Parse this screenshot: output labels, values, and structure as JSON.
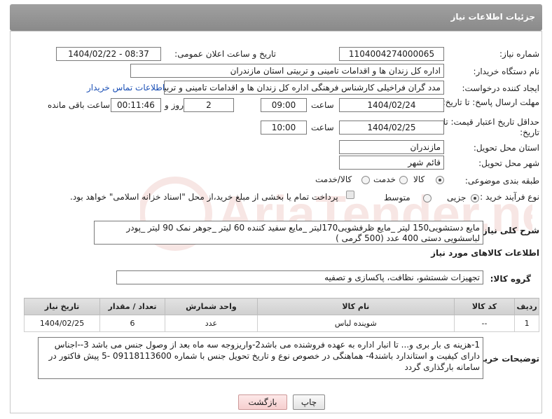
{
  "header": {
    "title": "جزئیات اطلاعات نیاز"
  },
  "labels": {
    "need_number": "شماره نیاز:",
    "announce_datetime": "تاریخ و ساعت اعلان عمومی:",
    "buyer_org": "نام دستگاه خریدار:",
    "requester": "ایجاد کننده درخواست:",
    "reply_deadline": "مهلت ارسال پاسخ: تا تاریخ:",
    "hour": "ساعت",
    "day_and": "روز و",
    "remaining": "ساعت باقی مانده",
    "min_price_validity": "حداقل تاریخ اعتبار قیمت: تا تاریخ:",
    "delivery_province": "استان محل تحویل:",
    "delivery_city": "شهر محل تحویل:",
    "category": "طبقه بندی موضوعی:",
    "purchase_type": "نوع فرآیند خرید :",
    "general_description": "شرح کلی نیاز:",
    "goods_info": "اطلاعات کالاهای مورد نیاز",
    "goods_group": "گروه کالا:",
    "buyer_notes": "توضیحات خریدار:"
  },
  "fields": {
    "need_number": "1104004274000065",
    "announce_datetime": "1404/02/22 - 08:37",
    "buyer_org": "اداره کل زندان ها و اقدامات تامینی و تربیتی استان مازندران",
    "requester": "مدد گران فراخیلی کارشناس فرهنگی اداره کل زندان ها و اقدامات تامینی و تربیتی",
    "reply_date": "1404/02/24",
    "reply_time": "09:00",
    "days": "2",
    "remaining_time": "00:11:46",
    "price_date": "1404/02/25",
    "price_time": "10:00",
    "province": "مازندران",
    "city": "قائم شهر",
    "general_description": "مایع دستشویی150 لیتر _مایع ظرفشویی170لیتر _مایع سفید کننده 60 لیتر _جوهر نمک 90 لیتر _پودر لباسشویی دستی 400 عدد (500 گرمی )",
    "goods_group": "تجهیزات شستشو، نظافت، پاکسازی و تصفیه",
    "buyer_notes": "1-هزینه ی بار بری و... تا انبار اداره به عهده فروشنده می باشد2-واریزوجه سه ماه بعد از وصول جنس می باشد 3--اجناس دارای کیفیت و استاندارد باشند4- هماهنگی در خصوص نوع و تاریخ تحویل جنس با شماره 09118113600 -5 پیش فاکتور در سامانه بارگذاری گردد"
  },
  "contact_link": "اطلاعات تماس خریدار",
  "category_options": {
    "goods": "کالا",
    "service": "خدمت",
    "goods_service": "کالا/خدمت",
    "selected": "کالا"
  },
  "purchase_options": {
    "partial": "جزیی",
    "medium": "متوسط",
    "selected": "جزیی"
  },
  "treasury_note": "پرداخت تمام یا بخشی از مبلغ خرید،از محل \"اسناد خزانه اسلامی\" خواهد بود.",
  "table": {
    "headers": [
      "ردیف",
      "کد کالا",
      "نام کالا",
      "واحد شمارش",
      "تعداد / مقدار",
      "تاریخ نیاز"
    ],
    "rows": [
      [
        "1",
        "--",
        "شوینده لباس",
        "عدد",
        "6",
        "1404/02/25"
      ]
    ]
  },
  "buttons": {
    "print": "چاپ",
    "back": "بازگشت"
  },
  "watermark": "AriaTender.neT",
  "colors": {
    "header": "#959595",
    "link": "#1a4fb5",
    "back_button": "#f6cfcf"
  }
}
